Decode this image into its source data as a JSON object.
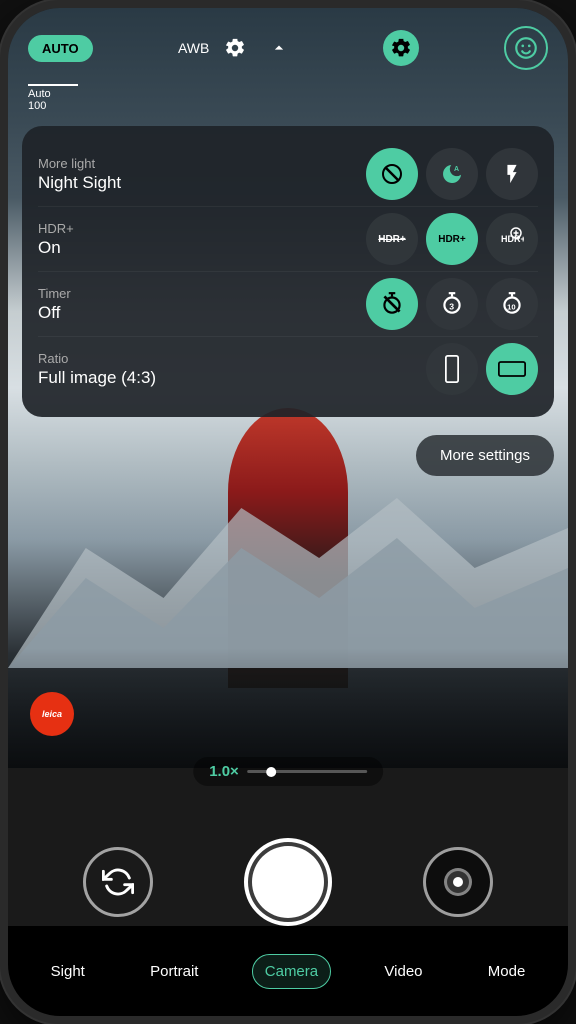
{
  "top_bar": {
    "auto_label": "AUTO",
    "awb_label": "AWB",
    "accent_color": "#4ecca3"
  },
  "exposure": {
    "label": "Auto",
    "value": "100"
  },
  "settings": {
    "rows": [
      {
        "label": "More light",
        "value": "Night Sight",
        "options": [
          {
            "icon": "off",
            "active": true,
            "label": "Off"
          },
          {
            "icon": "auto",
            "active": false,
            "label": "Auto"
          },
          {
            "icon": "flash",
            "active": false,
            "label": "Flash"
          }
        ]
      },
      {
        "label": "HDR+",
        "value": "On",
        "options": [
          {
            "icon": "hdr-off",
            "active": false,
            "label": "HDR+ Off"
          },
          {
            "icon": "hdr-on",
            "active": true,
            "label": "HDR+ On"
          },
          {
            "icon": "hdr-plus",
            "active": false,
            "label": "HDR+ Enhanced"
          }
        ]
      },
      {
        "label": "Timer",
        "value": "Off",
        "options": [
          {
            "icon": "timer-off",
            "active": true,
            "label": "Timer Off"
          },
          {
            "icon": "timer-3",
            "active": false,
            "label": "3 seconds"
          },
          {
            "icon": "timer-10",
            "active": false,
            "label": "10 seconds"
          }
        ]
      },
      {
        "label": "Ratio",
        "value": "Full image (4:3)",
        "options": [
          {
            "icon": "ratio-tall",
            "active": false,
            "label": "Tall ratio"
          },
          {
            "icon": "ratio-wide",
            "active": true,
            "label": "4:3 ratio"
          }
        ]
      }
    ],
    "more_settings_label": "More settings"
  },
  "leica": {
    "label": "leica"
  },
  "zoom": {
    "value": "1.0×"
  },
  "bottom_nav": {
    "items": [
      {
        "label": "Sight",
        "active": false
      },
      {
        "label": "Portrait",
        "active": false
      },
      {
        "label": "Camera",
        "active": true
      },
      {
        "label": "Video",
        "active": false
      },
      {
        "label": "Mode",
        "active": false
      }
    ]
  }
}
